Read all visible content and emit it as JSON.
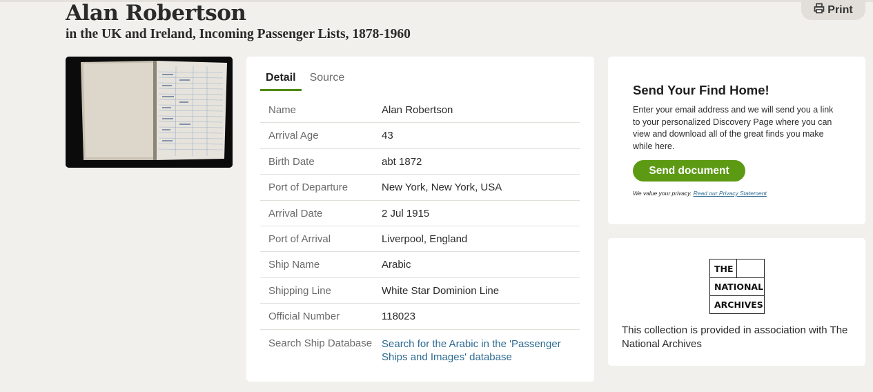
{
  "record": {
    "name": "Alan Robertson",
    "collection": "in the UK and Ireland, Incoming Passenger Lists, 1878-1960"
  },
  "toolbar": {
    "print_label": "Print",
    "print_icon": "printer-icon"
  },
  "tabs": [
    {
      "label": "Detail",
      "active": true
    },
    {
      "label": "Source",
      "active": false
    }
  ],
  "details": [
    {
      "label": "Name",
      "value": "Alan Robertson"
    },
    {
      "label": "Arrival Age",
      "value": "43"
    },
    {
      "label": "Birth Date",
      "value": "abt 1872"
    },
    {
      "label": "Port of Departure",
      "value": "New York, New York, USA"
    },
    {
      "label": "Arrival Date",
      "value": "2 Jul 1915"
    },
    {
      "label": "Port of Arrival",
      "value": "Liverpool, England"
    },
    {
      "label": "Ship Name",
      "value": "Arabic"
    },
    {
      "label": "Shipping Line",
      "value": "White Star Dominion Line"
    },
    {
      "label": "Official Number",
      "value": "118023"
    },
    {
      "label": "Search Ship Database",
      "value": "Search for the Arabic in the 'Passenger Ships and Images' database"
    }
  ],
  "send": {
    "title": "Send Your Find Home!",
    "text": "Enter your email address and we will send you a link to your personalized Discovery Page where you can view and download all of the great finds you make while here.",
    "button_label": "Send document",
    "privacy_text": "We value your privacy.",
    "privacy_link": "Read our Privacy Statement"
  },
  "archives": {
    "logo_line1": "THE",
    "logo_line2": "NATIONAL",
    "logo_line3": "ARCHIVES",
    "text": "This collection is provided in association with The National Archives"
  },
  "colors": {
    "accent_green": "#5c9a14",
    "tab_underline": "#4f8a14",
    "link_blue": "#2d6a92",
    "page_background": "#f2f0ed"
  }
}
